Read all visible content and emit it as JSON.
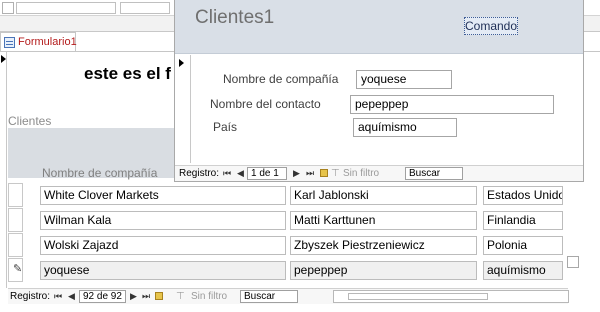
{
  "form_tab": {
    "label": "Formulario1"
  },
  "form": {
    "heading": "este es el f",
    "section_label": "Clientes",
    "column_header": "Nombre de compañía"
  },
  "rows": [
    {
      "company": "White Clover Markets",
      "contact": "Karl Jablonski",
      "country": "Estados Unidos"
    },
    {
      "company": "Wilman Kala",
      "contact": "Matti Karttunen",
      "country": "Finlandia"
    },
    {
      "company": "Wolski  Zajazd",
      "contact": "Zbyszek Piestrzeniewicz",
      "country": "Polonia"
    },
    {
      "company": "yoquese",
      "contact": "pepeppep",
      "country": "aquímismo"
    }
  ],
  "bottom_nav": {
    "label": "Registro:",
    "record": "92 de 92",
    "filter": "Sin filtro",
    "search": "Buscar"
  },
  "popup": {
    "title": "Clientes1",
    "button": "Comando",
    "fields": {
      "company_label": "Nombre de compañía",
      "company_value": "yoquese",
      "contact_label": "Nombre del contacto",
      "contact_value": "pepeppep",
      "country_label": "País",
      "country_value": "aquímismo"
    },
    "nav": {
      "label": "Registro:",
      "record": "1 de 1",
      "filter": "Sin filtro",
      "search": "Buscar"
    }
  },
  "icons": {
    "first": "first-record-icon",
    "prev": "previous-record-icon",
    "next": "next-record-icon",
    "last": "last-record-icon",
    "new": "new-record-icon",
    "filter": "filter-icon",
    "edit": "pencil-icon"
  },
  "colors": {
    "tab_text": "#b41c1c",
    "header_band": "#d9dfe7"
  }
}
